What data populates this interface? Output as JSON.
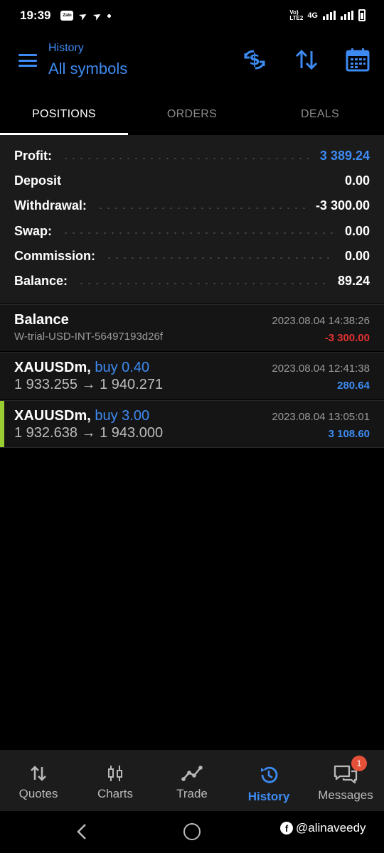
{
  "status_bar": {
    "time": "19:39",
    "zalo": "Zalo",
    "network": "4G",
    "volte": "Vo) LTE2"
  },
  "header": {
    "subtitle": "History",
    "title": "All symbols"
  },
  "tabs": [
    {
      "label": "POSITIONS",
      "active": true
    },
    {
      "label": "ORDERS",
      "active": false
    },
    {
      "label": "DEALS",
      "active": false
    }
  ],
  "summary": {
    "rows": [
      {
        "label": "Profit:",
        "value": "3 389.24"
      },
      {
        "label": "Deposit",
        "value": "0.00"
      },
      {
        "label": "Withdrawal:",
        "value": "-3 300.00"
      },
      {
        "label": "Swap:",
        "value": "0.00"
      },
      {
        "label": "Commission:",
        "value": "0.00"
      },
      {
        "label": "Balance:",
        "value": "89.24"
      }
    ]
  },
  "deals": [
    {
      "title": "Balance",
      "subtitle": "W-trial-USD-INT-56497193d26f",
      "time": "2023.08.04 14:38:26",
      "amount": "-3 300.00"
    },
    {
      "symbol": "XAUUSDm,",
      "direction": "buy 0.40",
      "prices": "1 933.255 → 1 940.271",
      "time": "2023.08.04 12:41:38",
      "amount": "280.64"
    },
    {
      "symbol": "XAUUSDm,",
      "direction": "buy 3.00",
      "prices": "1 932.638 → 1 943.000",
      "time": "2023.08.04 13:05:01",
      "amount": "3 108.60"
    }
  ],
  "bottom_nav": [
    {
      "label": "Quotes",
      "icon": "quotes-arrows-icon"
    },
    {
      "label": "Charts",
      "icon": "candlestick-icon"
    },
    {
      "label": "Trade",
      "icon": "trend-line-icon"
    },
    {
      "label": "History",
      "icon": "history-clock-icon",
      "active": true
    },
    {
      "label": "Messages",
      "icon": "chat-bubbles-icon",
      "badge": "1"
    }
  ],
  "watermark": "@alinaveedy",
  "colors": {
    "accent": "#3d8bf2",
    "negative": "#e03131",
    "marker": "#9acd32",
    "badge": "#e55039"
  }
}
